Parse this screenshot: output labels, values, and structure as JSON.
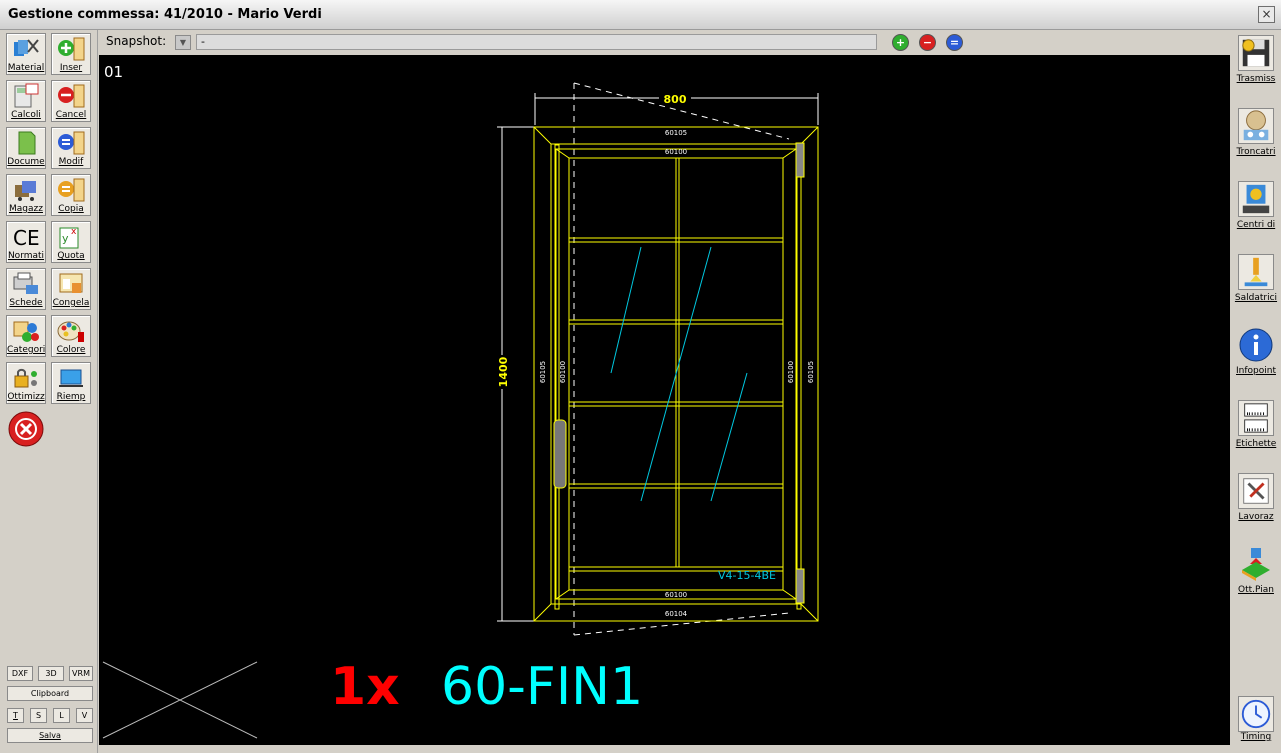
{
  "window": {
    "title": "Gestione commessa: 41/2010 - Mario Verdi",
    "close_label": "×"
  },
  "left_toolbar": {
    "buttons": [
      {
        "label": "Material",
        "icon": "materials-icon"
      },
      {
        "label": "Inser",
        "icon": "insert-icon"
      },
      {
        "label": "Calcoli",
        "icon": "calculator-icon"
      },
      {
        "label": "Cancel",
        "icon": "delete-icon"
      },
      {
        "label": "Docume",
        "icon": "document-icon"
      },
      {
        "label": "Modif",
        "icon": "modify-icon"
      },
      {
        "label": "Magazz",
        "icon": "warehouse-icon"
      },
      {
        "label": "Copia",
        "icon": "copy-icon"
      },
      {
        "label": "Normati",
        "icon": "ce-mark-icon"
      },
      {
        "label": "Quota",
        "icon": "quote-icon"
      },
      {
        "label": "Schede",
        "icon": "sheets-icon"
      },
      {
        "label": "Congela",
        "icon": "freeze-icon"
      },
      {
        "label": "Categori",
        "icon": "categories-icon"
      },
      {
        "label": "Colore",
        "icon": "palette-icon"
      },
      {
        "label": "Ottimizz",
        "icon": "lock-icon"
      },
      {
        "label": "Riemp",
        "icon": "fill-icon"
      }
    ],
    "view_buttons": [
      "DXF",
      "3D",
      "VRM"
    ],
    "clipboard_label": "Clipboard",
    "letter_buttons": [
      "T",
      "S",
      "L",
      "V"
    ],
    "save_label": "Salva"
  },
  "snapshot": {
    "label": "Snapshot:",
    "value": "-"
  },
  "canvas": {
    "page_number": "01",
    "quantity": "1x",
    "code": "60-FIN1",
    "drawing": {
      "width_dim": "800",
      "height_dim": "1400",
      "top_frame_code": "60105",
      "top_sash_code": "60100",
      "left_frame_code": "60105",
      "left_sash_code": "60100",
      "right_sash_code": "60100",
      "right_frame_code": "60105",
      "bottom_sash_code": "60100",
      "bottom_frame_code": "60104",
      "glass_label": "V4-15-4BE"
    }
  },
  "right_toolbar": {
    "buttons": [
      {
        "label": "Trasmiss",
        "icon": "floppy-transmit-icon"
      },
      {
        "label": "Troncatri",
        "icon": "cutter-icon"
      },
      {
        "label": "Centri di",
        "icon": "machining-center-icon"
      },
      {
        "label": "Saldatrici",
        "icon": "welder-icon"
      },
      {
        "label": "Infopoint",
        "icon": "info-icon"
      },
      {
        "label": "Etichette",
        "icon": "label-icon"
      },
      {
        "label": "Lavoraz",
        "icon": "tools-icon"
      },
      {
        "label": "Ott.Pian",
        "icon": "optimize-plan-icon"
      },
      {
        "label": "Timing",
        "icon": "clock-icon"
      }
    ]
  }
}
